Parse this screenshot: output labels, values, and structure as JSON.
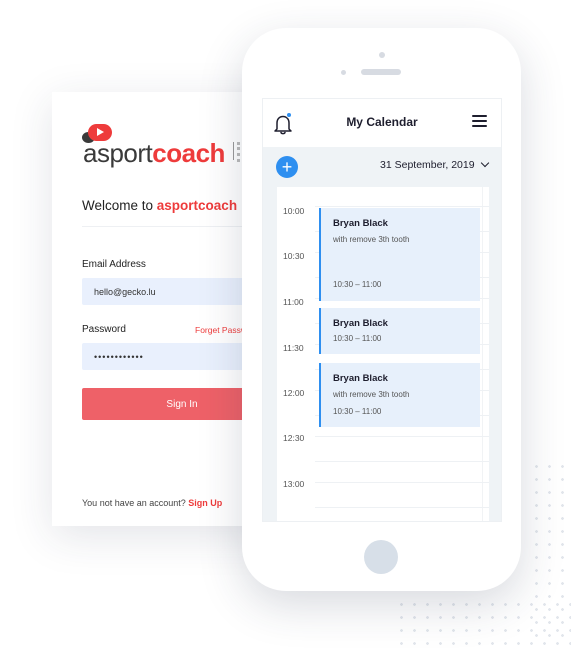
{
  "login": {
    "brand_prefix": "a",
    "brand_sport": "sport",
    "brand_coach": "coach",
    "welcome_prefix": "Welcome to ",
    "welcome_brand_a": "a",
    "welcome_brand_sport": "sport",
    "welcome_brand_coach": "coach",
    "email_label": "Email Address",
    "email_value": "hello@gecko.lu",
    "password_label": "Password",
    "forgot_label": "Forget Password",
    "password_value": "••••••••••••",
    "signin_label": "Sign In",
    "signup_prompt": "You not have an account?",
    "signup_link": "Sign Up"
  },
  "calendar": {
    "title": "My Calendar",
    "date": "31 September, 2019",
    "add_icon": "plus-icon",
    "notification_icon": "bell-icon",
    "menu_icon": "menu-icon",
    "times": [
      "10:00",
      "10:30",
      "11:00",
      "11:30",
      "12:00",
      "12:30",
      "13:00"
    ],
    "events": [
      {
        "name": "Bryan Black",
        "description": "with remove 3th tooth",
        "time": "10:30 – 11:00"
      },
      {
        "name": "Bryan Black",
        "description": "",
        "time": "10:30 – 11:00"
      },
      {
        "name": "Bryan Black",
        "description": "with remove 3th tooth",
        "time": "10:30 – 11:00"
      }
    ]
  },
  "colors": {
    "brand_red": "#ee3b3b",
    "signin_button": "#ee6168",
    "accent_blue": "#2e8ff0",
    "input_bg": "#e9f0fd",
    "event_bg": "#e7f0fb"
  }
}
